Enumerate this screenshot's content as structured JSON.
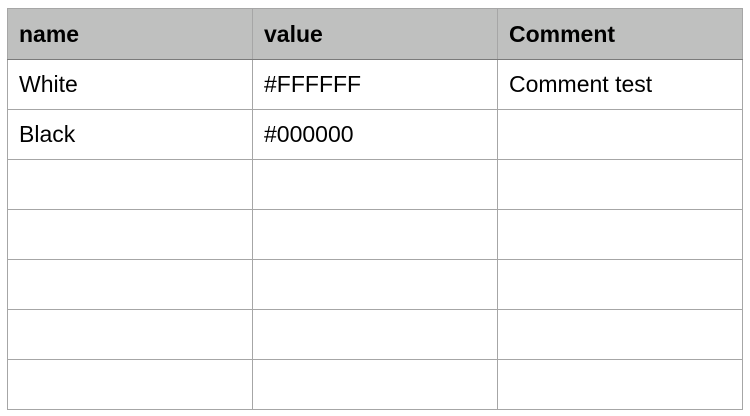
{
  "table": {
    "columns": [
      "name",
      "value",
      "Comment"
    ],
    "rows": [
      [
        "White",
        "#FFFFFF",
        "Comment test"
      ],
      [
        "Black",
        "#000000",
        ""
      ],
      [
        "",
        "",
        ""
      ],
      [
        "",
        "",
        ""
      ],
      [
        "",
        "",
        ""
      ],
      [
        "",
        "",
        ""
      ],
      [
        "",
        "",
        ""
      ]
    ]
  },
  "colors": {
    "header_bg": "#BFC0BF",
    "grid_line": "#A6A6A6",
    "cell_bg": "#FFFFFF"
  }
}
